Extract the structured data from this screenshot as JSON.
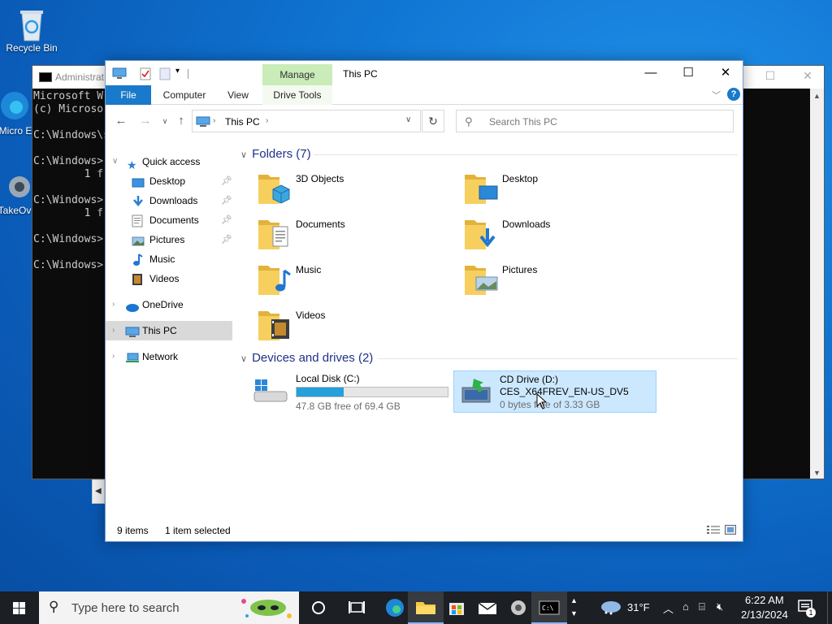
{
  "desktop": {
    "icons": [
      {
        "label": "Recycle Bin"
      },
      {
        "label": "Micro Ed"
      },
      {
        "label": "TakeOv"
      }
    ]
  },
  "cmd": {
    "title": "Administrat",
    "lines": [
      "Microsoft W",
      "(c) Microso",
      "",
      "C:\\Windows\\s",
      "",
      "C:\\Windows>",
      "        1 f",
      "",
      "C:\\Windows>",
      "        1 f",
      "",
      "C:\\Windows>",
      "",
      "C:\\Windows>"
    ]
  },
  "explorer": {
    "title": "This PC",
    "manage_tab": "Manage",
    "ribbon_tabs": [
      "File",
      "Computer",
      "View",
      "Drive Tools"
    ],
    "address": {
      "crumb": "This PC"
    },
    "search": {
      "placeholder": "Search This PC"
    },
    "nav": {
      "quick_access": "Quick access",
      "quick_items": [
        {
          "label": "Desktop",
          "pinned": true
        },
        {
          "label": "Downloads",
          "pinned": true
        },
        {
          "label": "Documents",
          "pinned": true
        },
        {
          "label": "Pictures",
          "pinned": true
        },
        {
          "label": "Music",
          "pinned": false
        },
        {
          "label": "Videos",
          "pinned": false
        }
      ],
      "onedrive": "OneDrive",
      "this_pc": "This PC",
      "network": "Network"
    },
    "folders_header": "Folders (7)",
    "folders": [
      {
        "label": "3D Objects",
        "icon": "3d-objects-icon"
      },
      {
        "label": "Desktop",
        "icon": "desktop-folder-icon"
      },
      {
        "label": "Documents",
        "icon": "documents-folder-icon"
      },
      {
        "label": "Downloads",
        "icon": "downloads-folder-icon"
      },
      {
        "label": "Music",
        "icon": "music-folder-icon"
      },
      {
        "label": "Pictures",
        "icon": "pictures-folder-icon"
      },
      {
        "label": "Videos",
        "icon": "videos-folder-icon"
      }
    ],
    "drives_header": "Devices and drives (2)",
    "drives": [
      {
        "name": "Local Disk (C:)",
        "free": "47.8 GB free of 69.4 GB",
        "used_fraction": 0.31
      },
      {
        "name": "CD Drive (D:)",
        "label2": "CES_X64FREV_EN-US_DV5",
        "free": "0 bytes free of 3.33 GB"
      }
    ],
    "status": {
      "items": "9 items",
      "selected": "1 item selected"
    }
  },
  "taskbar": {
    "search_placeholder": "Type here to search",
    "weather": "31°F",
    "time": "6:22 AM",
    "date": "2/13/2024",
    "notification_count": "1"
  },
  "colors": {
    "accent": "#1979ca",
    "selection": "#cce8ff",
    "manage_tab": "#c9ecb9",
    "progress": "#26a0da"
  }
}
